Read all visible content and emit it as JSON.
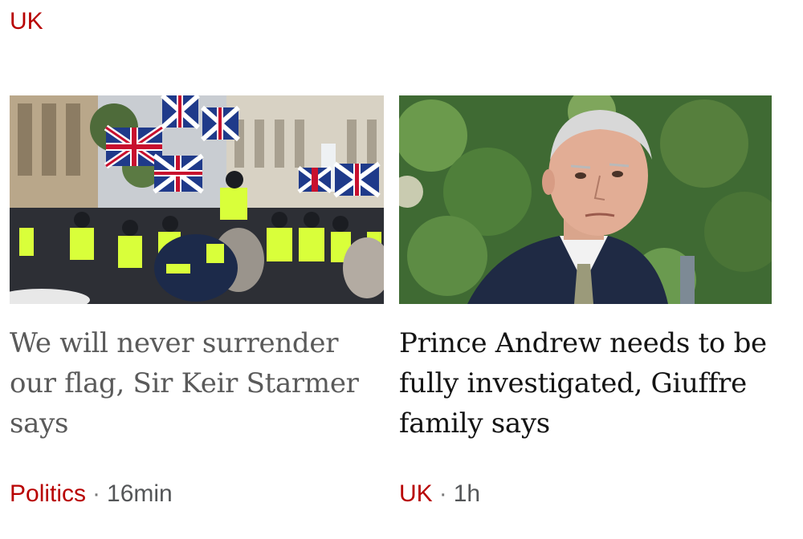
{
  "section": {
    "label": "UK"
  },
  "cards": [
    {
      "image_alt": "Police officers in hi-vis jackets facing a crowd waving Union flags",
      "headline": "We will never surrender our flag, Sir Keir Starmer says",
      "topic": "Politics",
      "separator": "·",
      "time": "16min"
    },
    {
      "image_alt": "Prince Andrew in a suit and tie in front of green foliage",
      "headline": "Prince Andrew needs to be fully investigated, Giuffre family says",
      "topic": "UK",
      "separator": "·",
      "time": "1h"
    }
  ],
  "colors": {
    "accent": "#b80000",
    "meta_grey": "#545658",
    "headline_visited": "#5a5a5a",
    "headline_default": "#141414"
  }
}
